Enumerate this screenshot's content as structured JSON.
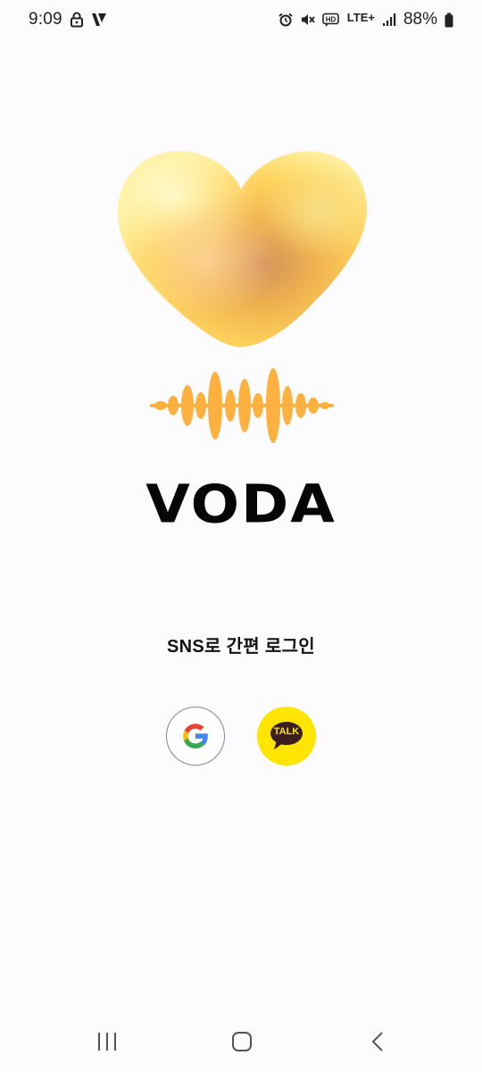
{
  "status_bar": {
    "time": "9:09",
    "network": "LTE+",
    "battery": "88%",
    "icons": [
      "lock-icon",
      "vpn-icon",
      "alarm-icon",
      "mute-icon",
      "hd-voice-icon",
      "signal-icon",
      "battery-icon"
    ]
  },
  "app": {
    "name": "VODA",
    "logo_icons": [
      "heart-logo-icon",
      "sound-wave-icon"
    ]
  },
  "login": {
    "title": "SNS로 간편 로그인",
    "buttons": [
      {
        "icon": "google-g-icon"
      },
      {
        "icon": "kakao-talk-icon",
        "label": "TALK"
      }
    ]
  },
  "nav_bar": {
    "icons": [
      "recent-apps-icon",
      "home-icon",
      "back-icon"
    ]
  },
  "colors": {
    "background": "#fcfbfe",
    "heart_light": "#fff3a0",
    "heart_mid": "#ffcf4f",
    "heart_dark": "#d88f55",
    "wave": "#ffb13f",
    "kakao_yellow": "#fde500",
    "kakao_brown": "#3b1e1e",
    "google_blue": "#4285f4",
    "google_red": "#ea4335",
    "google_yellow": "#fbbc05",
    "google_green": "#34a853"
  }
}
